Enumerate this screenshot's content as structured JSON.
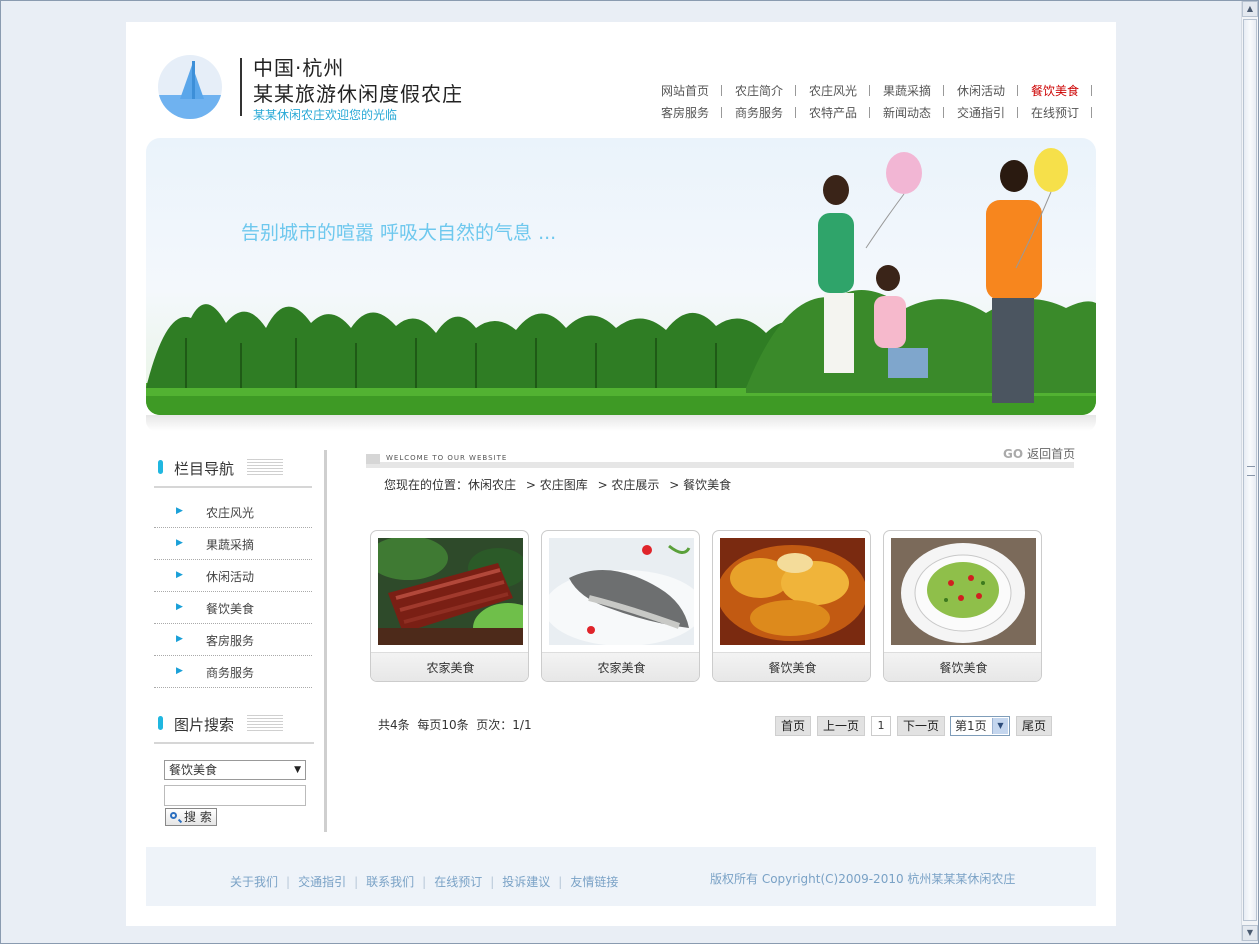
{
  "header": {
    "logo_line1": "中国·杭州",
    "logo_line2": "某某旅游休闲度假农庄",
    "logo_slogan": "某某休闲农庄欢迎您的光临"
  },
  "nav": {
    "row1": [
      {
        "label": "网站首页"
      },
      {
        "label": "农庄简介"
      },
      {
        "label": "农庄风光"
      },
      {
        "label": "果蔬采摘"
      },
      {
        "label": "休闲活动"
      },
      {
        "label": "餐饮美食",
        "active": true
      }
    ],
    "row2": [
      {
        "label": "客房服务"
      },
      {
        "label": "商务服务"
      },
      {
        "label": "农特产品"
      },
      {
        "label": "新闻动态"
      },
      {
        "label": "交通指引"
      },
      {
        "label": "在线预订"
      }
    ]
  },
  "banner": {
    "slogan": "告别城市的喧嚣 呼吸大自然的气息 ..."
  },
  "sidebar": {
    "nav_title": "栏目导航",
    "items": [
      "农庄风光",
      "果蔬采摘",
      "休闲活动",
      "餐饮美食",
      "客房服务",
      "商务服务"
    ],
    "search_title": "图片搜索",
    "search_select": "餐饮美食",
    "search_button": "搜 索"
  },
  "main": {
    "welcome_text": "WELCOME TO OUR WEBSITE",
    "go_label": "GO",
    "home_link": "返回首页",
    "breadcrumb": {
      "prefix": "您现在的位置：",
      "parts": [
        "休闲农庄",
        "> 农庄图库",
        "> 农庄展示",
        "> 餐饮美食"
      ]
    },
    "cards": [
      {
        "caption": "农家美食",
        "image": "braised-pork-photo"
      },
      {
        "caption": "农家美食",
        "image": "steamed-fish-photo"
      },
      {
        "caption": "餐饮美食",
        "image": "glazed-chicken-photo"
      },
      {
        "caption": "餐饮美食",
        "image": "green-pepper-dish-photo"
      }
    ],
    "pagination": {
      "total_label": "共",
      "total": "4",
      "total_unit": "条",
      "per_page_label": "每页",
      "per_page": "10",
      "per_page_unit": "条",
      "pages_label": "页次：",
      "pages": "1/1",
      "first": "首页",
      "prev": "上一页",
      "current": "1",
      "next": "下一页",
      "select": "第1页",
      "last": "尾页"
    }
  },
  "footer": {
    "links": [
      "关于我们",
      "交通指引",
      "联系我们",
      "在线预订",
      "投诉建议",
      "友情链接"
    ],
    "copyright": "版权所有  Copyright(C)2009-2010 杭州某某某休闲农庄"
  },
  "colors": {
    "accent": "#20b7e0",
    "active_nav": "#cc0000",
    "footer_text": "#7aa2c6"
  }
}
